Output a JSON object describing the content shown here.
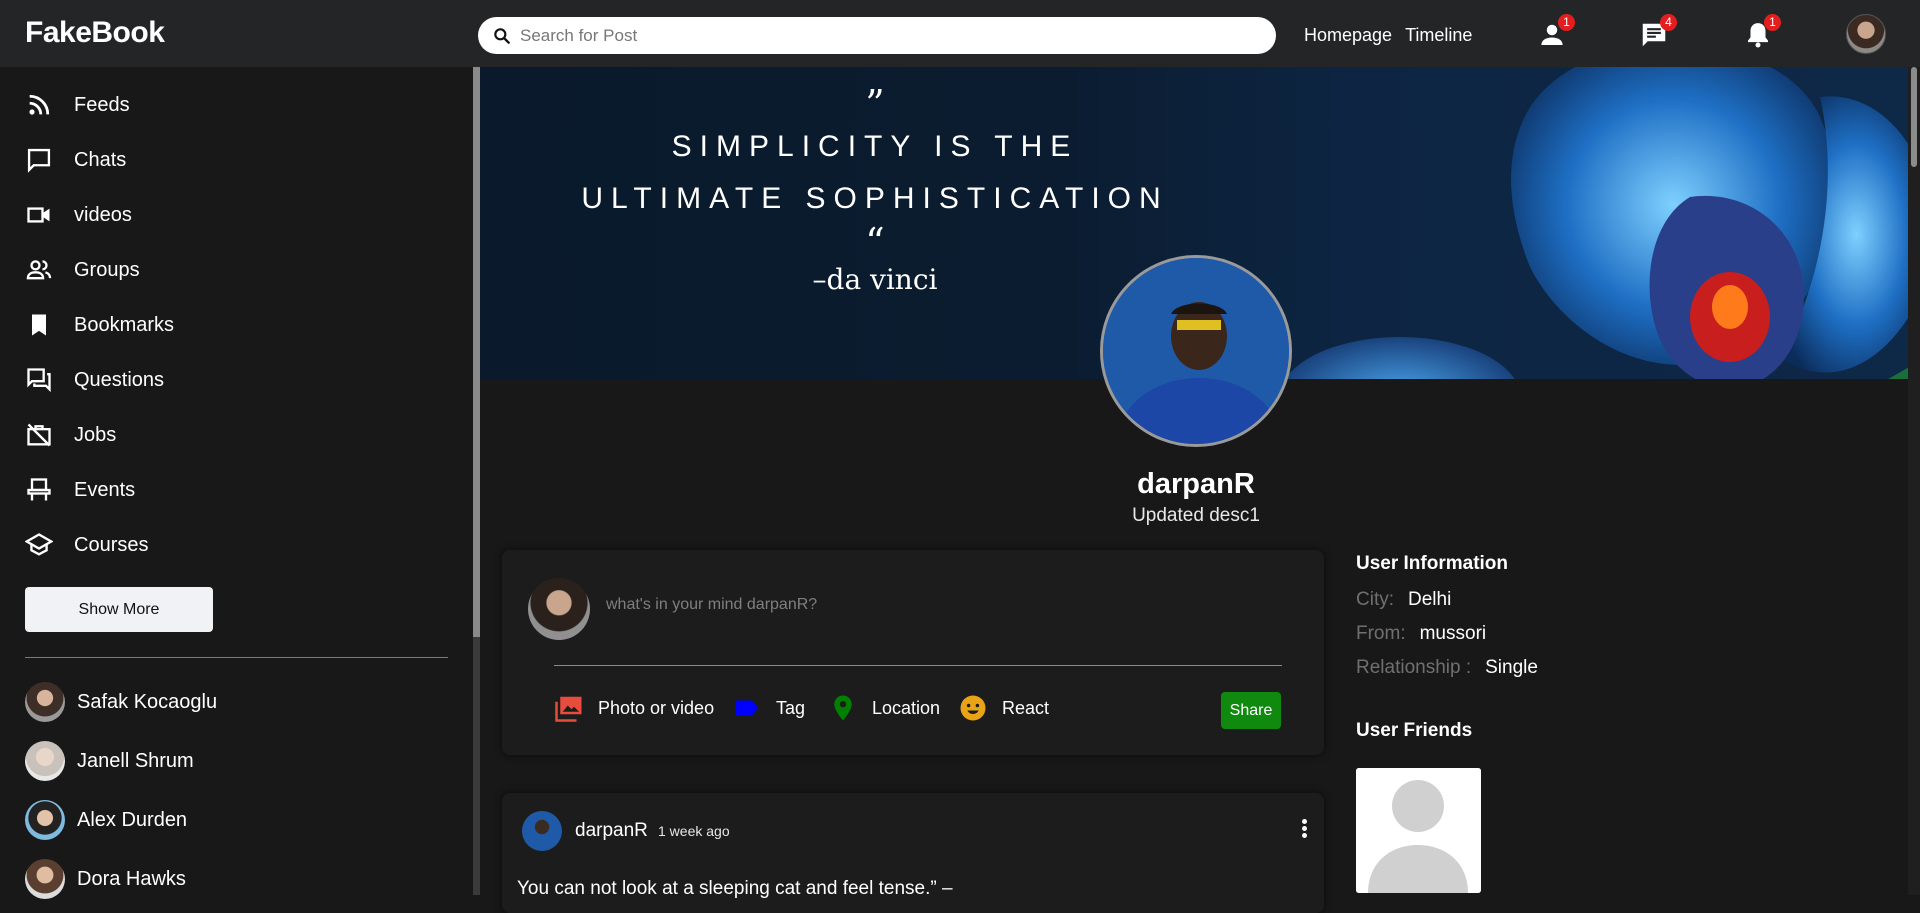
{
  "header": {
    "logo": "FakeBook",
    "search_placeholder": "Search for Post",
    "nav_links": [
      "Homepage",
      "Timeline"
    ],
    "badges": {
      "friends": "1",
      "messages": "4",
      "notifications": "1"
    }
  },
  "sidebar": {
    "items": [
      {
        "label": "Feeds",
        "icon": "rss-icon"
      },
      {
        "label": "Chats",
        "icon": "chat-icon"
      },
      {
        "label": "videos",
        "icon": "video-icon"
      },
      {
        "label": "Groups",
        "icon": "group-icon"
      },
      {
        "label": "Bookmarks",
        "icon": "bookmark-icon"
      },
      {
        "label": "Questions",
        "icon": "question-icon"
      },
      {
        "label": "Jobs",
        "icon": "work-off-icon"
      },
      {
        "label": "Events",
        "icon": "event-icon"
      },
      {
        "label": "Courses",
        "icon": "school-icon"
      }
    ],
    "show_more_label": "Show More",
    "friends": [
      "Safak Kocaoglu",
      "Janell Shrum",
      "Alex Durden",
      "Dora Hawks"
    ]
  },
  "cover": {
    "quote_open": "”",
    "quote_line1": "SIMPLICITY IS THE",
    "quote_line2": "ULTIMATE SOPHISTICATION",
    "quote_close": "“",
    "quote_author": "–da vinci"
  },
  "profile": {
    "name": "darpanR",
    "description": "Updated desc1"
  },
  "composer": {
    "placeholder": "what's in your mind darpanR?",
    "options": [
      {
        "label": "Photo or video",
        "icon": "photo-icon",
        "color": "#e74c3c"
      },
      {
        "label": "Tag",
        "icon": "label-icon",
        "color": "#0000ff"
      },
      {
        "label": "Location",
        "icon": "location-icon",
        "color": "#008000"
      },
      {
        "label": "React",
        "icon": "emoji-icon",
        "color": "#e8a317"
      }
    ],
    "share_label": "Share"
  },
  "post": {
    "author": "darpanR",
    "time": "1 week ago",
    "text": "You can not look at a sleeping cat and feel tense.” –"
  },
  "user_info": {
    "title": "User Information",
    "rows": [
      {
        "key": "City:",
        "value": "Delhi"
      },
      {
        "key": "From:",
        "value": "mussori"
      },
      {
        "key": "Relationship :",
        "value": "Single"
      }
    ],
    "friends_title": "User Friends"
  },
  "colors": {
    "background": "#181818",
    "topbar": "#242526",
    "share": "#0f8a0f",
    "badge": "#e41e1e"
  }
}
